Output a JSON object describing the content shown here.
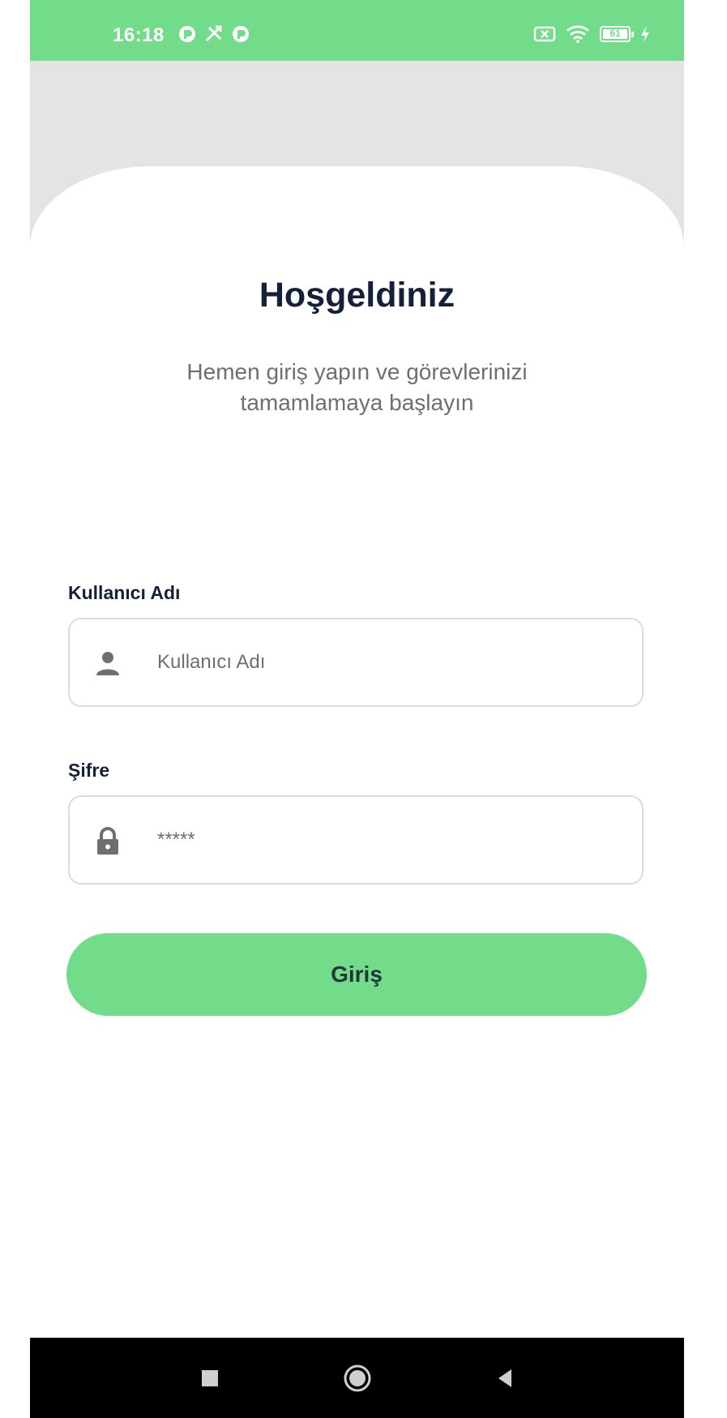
{
  "status_bar": {
    "time": "16:18",
    "battery": "61",
    "accent_color": "#72dc8b"
  },
  "login": {
    "title": "Hoşgeldiniz",
    "subtitle": "Hemen giriş yapın ve görevlerinizi tamamlamaya başlayın",
    "username": {
      "label": "Kullanıcı Adı",
      "placeholder": "Kullanıcı Adı",
      "icon": "person-icon"
    },
    "password": {
      "label": "Şifre",
      "placeholder": "*****",
      "icon": "lock-icon"
    },
    "submit_label": "Giriş"
  },
  "nav_bar": {
    "buttons": [
      "recents-icon",
      "home-icon",
      "back-icon"
    ]
  }
}
